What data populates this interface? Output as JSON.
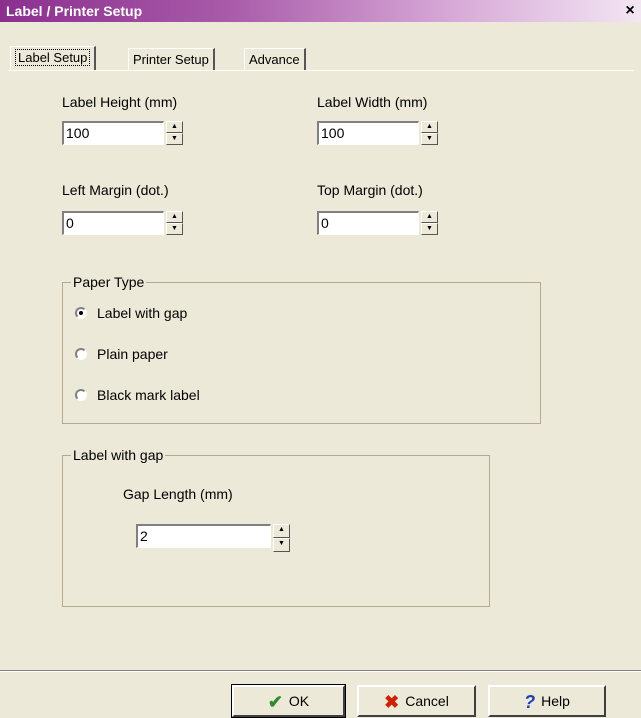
{
  "window": {
    "title": "Label / Printer Setup",
    "close_glyph": "×"
  },
  "tabs": [
    {
      "label": "Label Setup",
      "active": true
    },
    {
      "label": "Printer Setup",
      "active": false
    },
    {
      "label": "Advance",
      "active": false
    }
  ],
  "fields": {
    "label_height": {
      "label": "Label Height (mm)",
      "value": "100"
    },
    "label_width": {
      "label": "Label Width (mm)",
      "value": "100"
    },
    "left_margin": {
      "label": "Left Margin (dot.)",
      "value": "0"
    },
    "top_margin": {
      "label": "Top Margin (dot.)",
      "value": "0"
    }
  },
  "paper_type": {
    "legend": "Paper Type",
    "options": [
      {
        "label": "Label with gap",
        "selected": true
      },
      {
        "label": "Plain paper",
        "selected": false
      },
      {
        "label": "Black mark label",
        "selected": false
      }
    ]
  },
  "gap_group": {
    "legend": "Label with gap",
    "gap_length": {
      "label": "Gap Length (mm)",
      "value": "2"
    }
  },
  "buttons": {
    "ok": {
      "label": "OK",
      "icon": "checkmark-icon",
      "glyph": "✔",
      "color": "#2e8b2e"
    },
    "cancel": {
      "label": "Cancel",
      "icon": "x-icon",
      "glyph": "✖",
      "color": "#cc2200"
    },
    "help": {
      "label": "Help",
      "icon": "question-icon",
      "glyph": "?",
      "color": "#1a3fb5"
    }
  },
  "colors": {
    "title_gradient_start": "#8b2f8f",
    "window_bg": "#ece9d8"
  }
}
